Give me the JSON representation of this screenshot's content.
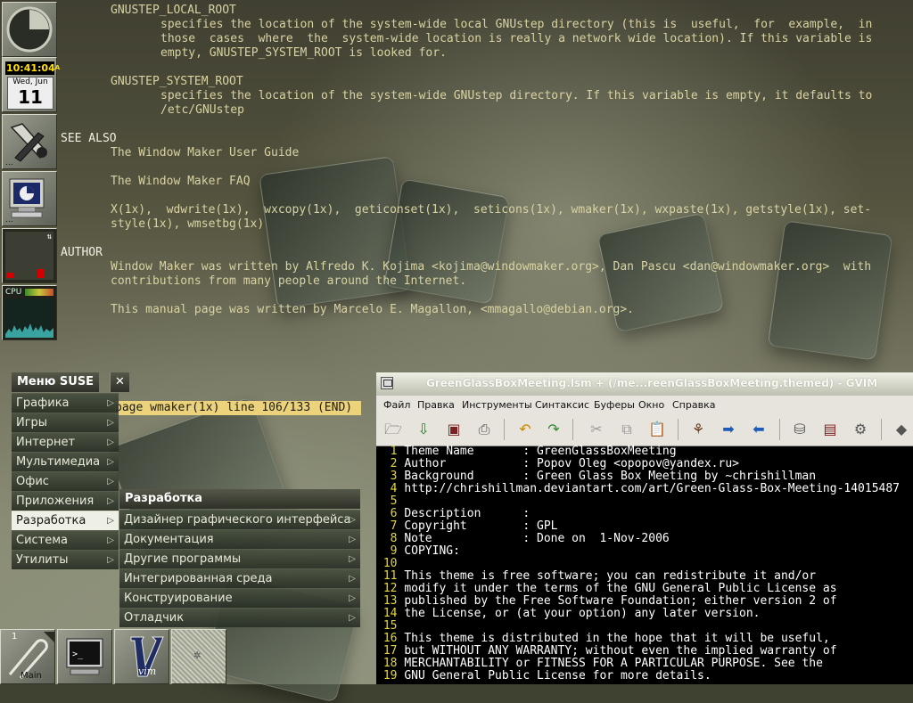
{
  "man_page": {
    "lines": [
      {
        "text": "GNUSTEP_LOCAL_ROOT",
        "indent": 1,
        "row": 0
      },
      {
        "text": "specifies the location of the system-wide local GNUstep directory (this is  useful,  for  example,  in",
        "indent": 2,
        "row": 1
      },
      {
        "text": "those  cases  where  the  system-wide location is really a network wide location). If this variable is",
        "indent": 2,
        "row": 2
      },
      {
        "text": "empty, GNUSTEP_SYSTEM_ROOT is looked for.",
        "indent": 2,
        "row": 3
      },
      {
        "text": "GNUSTEP_SYSTEM_ROOT",
        "indent": 1,
        "row": 5
      },
      {
        "text": "specifies the location of the system-wide GNUstep directory. If this variable is empty, it defaults to",
        "indent": 2,
        "row": 6
      },
      {
        "text": "/etc/GNUstep",
        "indent": 2,
        "row": 7
      },
      {
        "text": "SEE ALSO",
        "indent": 0,
        "row": 9,
        "heading": true
      },
      {
        "text": "The Window Maker User Guide",
        "indent": 1,
        "row": 10
      },
      {
        "text": "The Window Maker FAQ",
        "indent": 1,
        "row": 12
      },
      {
        "text": "X(1x),  wdwrite(1x),  wxcopy(1x),  geticonset(1x),  seticons(1x), wmaker(1x), wxpaste(1x), getstyle(1x), set-",
        "indent": 1,
        "row": 14
      },
      {
        "text": "style(1x), wmsetbg(1x)",
        "indent": 1,
        "row": 15
      },
      {
        "text": "AUTHOR",
        "indent": 0,
        "row": 17,
        "heading": true
      },
      {
        "text": "Window Maker was written by Alfredo K. Kojima <kojima@windowmaker.org>, Dan Pascu <dan@windowmaker.org>  with",
        "indent": 1,
        "row": 18
      },
      {
        "text": "contributions from many people around the Internet.",
        "indent": 1,
        "row": 19
      },
      {
        "text": "This manual page was written by Marcelo E. Magallon, <mmagallo@debian.org>.",
        "indent": 1,
        "row": 21
      }
    ],
    "pager_status": "page wmaker(1x) line 106/133 (END)"
  },
  "dock": {
    "clock_time": "10:41:04",
    "clock_ampm": "A",
    "date_weekday": "Wed, Jun",
    "date_day": "11",
    "ellipsis": "...",
    "cpu_label": "CPU"
  },
  "clip": {
    "workspace_number": "1",
    "workspace_name": "Main"
  },
  "menu_suse": {
    "title": "Меню SUSE",
    "close": "✕",
    "items": [
      "Графика",
      "Игры",
      "Интернет",
      "Мультимедиа",
      "Офис",
      "Приложения",
      "Разработка",
      "Система",
      "Утилиты"
    ],
    "selected_index": 6
  },
  "menu_dev": {
    "title": "Разработка",
    "items": [
      "Дизайнер графического интерфейса",
      "Документация",
      "Другие программы",
      "Интегрированная среда",
      "Конструирование",
      "Отладчик"
    ]
  },
  "gvim": {
    "title": "GreenGlassBoxMeeting.lsm + (/me...reenGlassBoxMeeting.themed) - GVIM",
    "menu": [
      "Файл",
      "Правка",
      "Инструменты",
      "Синтаксис",
      "Буферы",
      "Окно",
      "Справка"
    ],
    "lines": [
      "Theme Name       : GreenGlassBoxMeeting",
      "Author           : Popov Oleg <opopov@yandex.ru>",
      "Background       : Green Glass Box Meeting by ~chrishillman",
      "http://chrishillman.deviantart.com/art/Green-Glass-Box-Meeting-14015487",
      "",
      "Description      :",
      "Copyright        : GPL",
      "Note             : Done on  1-Nov-2006",
      "COPYING:",
      "",
      "This theme is free software; you can redistribute it and/or",
      "modify it under the terms of the GNU General Public License as",
      "published by the Free Software Foundation; either version 2 of",
      "the License, or (at your option) any later version.",
      "",
      "This theme is distributed in the hope that it will be useful,",
      "but WITHOUT ANY WARRANTY; without even the implied warranty of",
      "MERCHANTABILITY or FITNESS FOR A PARTICULAR PURPOSE. See the",
      "GNU General Public License for more details."
    ]
  }
}
